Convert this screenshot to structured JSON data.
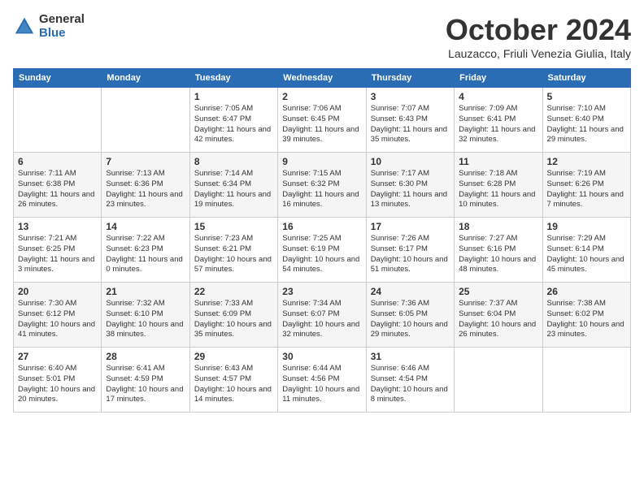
{
  "logo": {
    "general": "General",
    "blue": "Blue"
  },
  "title": "October 2024",
  "location": "Lauzacco, Friuli Venezia Giulia, Italy",
  "days_of_week": [
    "Sunday",
    "Monday",
    "Tuesday",
    "Wednesday",
    "Thursday",
    "Friday",
    "Saturday"
  ],
  "weeks": [
    [
      {
        "day": "",
        "detail": ""
      },
      {
        "day": "",
        "detail": ""
      },
      {
        "day": "1",
        "detail": "Sunrise: 7:05 AM\nSunset: 6:47 PM\nDaylight: 11 hours and 42 minutes."
      },
      {
        "day": "2",
        "detail": "Sunrise: 7:06 AM\nSunset: 6:45 PM\nDaylight: 11 hours and 39 minutes."
      },
      {
        "day": "3",
        "detail": "Sunrise: 7:07 AM\nSunset: 6:43 PM\nDaylight: 11 hours and 35 minutes."
      },
      {
        "day": "4",
        "detail": "Sunrise: 7:09 AM\nSunset: 6:41 PM\nDaylight: 11 hours and 32 minutes."
      },
      {
        "day": "5",
        "detail": "Sunrise: 7:10 AM\nSunset: 6:40 PM\nDaylight: 11 hours and 29 minutes."
      }
    ],
    [
      {
        "day": "6",
        "detail": "Sunrise: 7:11 AM\nSunset: 6:38 PM\nDaylight: 11 hours and 26 minutes."
      },
      {
        "day": "7",
        "detail": "Sunrise: 7:13 AM\nSunset: 6:36 PM\nDaylight: 11 hours and 23 minutes."
      },
      {
        "day": "8",
        "detail": "Sunrise: 7:14 AM\nSunset: 6:34 PM\nDaylight: 11 hours and 19 minutes."
      },
      {
        "day": "9",
        "detail": "Sunrise: 7:15 AM\nSunset: 6:32 PM\nDaylight: 11 hours and 16 minutes."
      },
      {
        "day": "10",
        "detail": "Sunrise: 7:17 AM\nSunset: 6:30 PM\nDaylight: 11 hours and 13 minutes."
      },
      {
        "day": "11",
        "detail": "Sunrise: 7:18 AM\nSunset: 6:28 PM\nDaylight: 11 hours and 10 minutes."
      },
      {
        "day": "12",
        "detail": "Sunrise: 7:19 AM\nSunset: 6:26 PM\nDaylight: 11 hours and 7 minutes."
      }
    ],
    [
      {
        "day": "13",
        "detail": "Sunrise: 7:21 AM\nSunset: 6:25 PM\nDaylight: 11 hours and 3 minutes."
      },
      {
        "day": "14",
        "detail": "Sunrise: 7:22 AM\nSunset: 6:23 PM\nDaylight: 11 hours and 0 minutes."
      },
      {
        "day": "15",
        "detail": "Sunrise: 7:23 AM\nSunset: 6:21 PM\nDaylight: 10 hours and 57 minutes."
      },
      {
        "day": "16",
        "detail": "Sunrise: 7:25 AM\nSunset: 6:19 PM\nDaylight: 10 hours and 54 minutes."
      },
      {
        "day": "17",
        "detail": "Sunrise: 7:26 AM\nSunset: 6:17 PM\nDaylight: 10 hours and 51 minutes."
      },
      {
        "day": "18",
        "detail": "Sunrise: 7:27 AM\nSunset: 6:16 PM\nDaylight: 10 hours and 48 minutes."
      },
      {
        "day": "19",
        "detail": "Sunrise: 7:29 AM\nSunset: 6:14 PM\nDaylight: 10 hours and 45 minutes."
      }
    ],
    [
      {
        "day": "20",
        "detail": "Sunrise: 7:30 AM\nSunset: 6:12 PM\nDaylight: 10 hours and 41 minutes."
      },
      {
        "day": "21",
        "detail": "Sunrise: 7:32 AM\nSunset: 6:10 PM\nDaylight: 10 hours and 38 minutes."
      },
      {
        "day": "22",
        "detail": "Sunrise: 7:33 AM\nSunset: 6:09 PM\nDaylight: 10 hours and 35 minutes."
      },
      {
        "day": "23",
        "detail": "Sunrise: 7:34 AM\nSunset: 6:07 PM\nDaylight: 10 hours and 32 minutes."
      },
      {
        "day": "24",
        "detail": "Sunrise: 7:36 AM\nSunset: 6:05 PM\nDaylight: 10 hours and 29 minutes."
      },
      {
        "day": "25",
        "detail": "Sunrise: 7:37 AM\nSunset: 6:04 PM\nDaylight: 10 hours and 26 minutes."
      },
      {
        "day": "26",
        "detail": "Sunrise: 7:38 AM\nSunset: 6:02 PM\nDaylight: 10 hours and 23 minutes."
      }
    ],
    [
      {
        "day": "27",
        "detail": "Sunrise: 6:40 AM\nSunset: 5:01 PM\nDaylight: 10 hours and 20 minutes."
      },
      {
        "day": "28",
        "detail": "Sunrise: 6:41 AM\nSunset: 4:59 PM\nDaylight: 10 hours and 17 minutes."
      },
      {
        "day": "29",
        "detail": "Sunrise: 6:43 AM\nSunset: 4:57 PM\nDaylight: 10 hours and 14 minutes."
      },
      {
        "day": "30",
        "detail": "Sunrise: 6:44 AM\nSunset: 4:56 PM\nDaylight: 10 hours and 11 minutes."
      },
      {
        "day": "31",
        "detail": "Sunrise: 6:46 AM\nSunset: 4:54 PM\nDaylight: 10 hours and 8 minutes."
      },
      {
        "day": "",
        "detail": ""
      },
      {
        "day": "",
        "detail": ""
      }
    ]
  ]
}
